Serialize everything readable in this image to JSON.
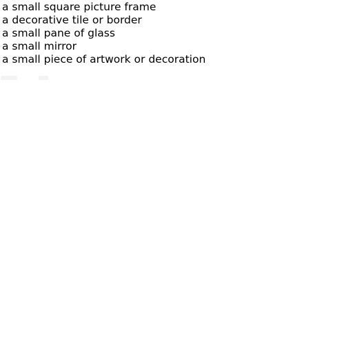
{
  "items": [
    "a small square picture frame",
    "a decorative tile or border",
    "a small pane of glass",
    "a small mirror",
    "a small piece of artwork or decoration"
  ]
}
